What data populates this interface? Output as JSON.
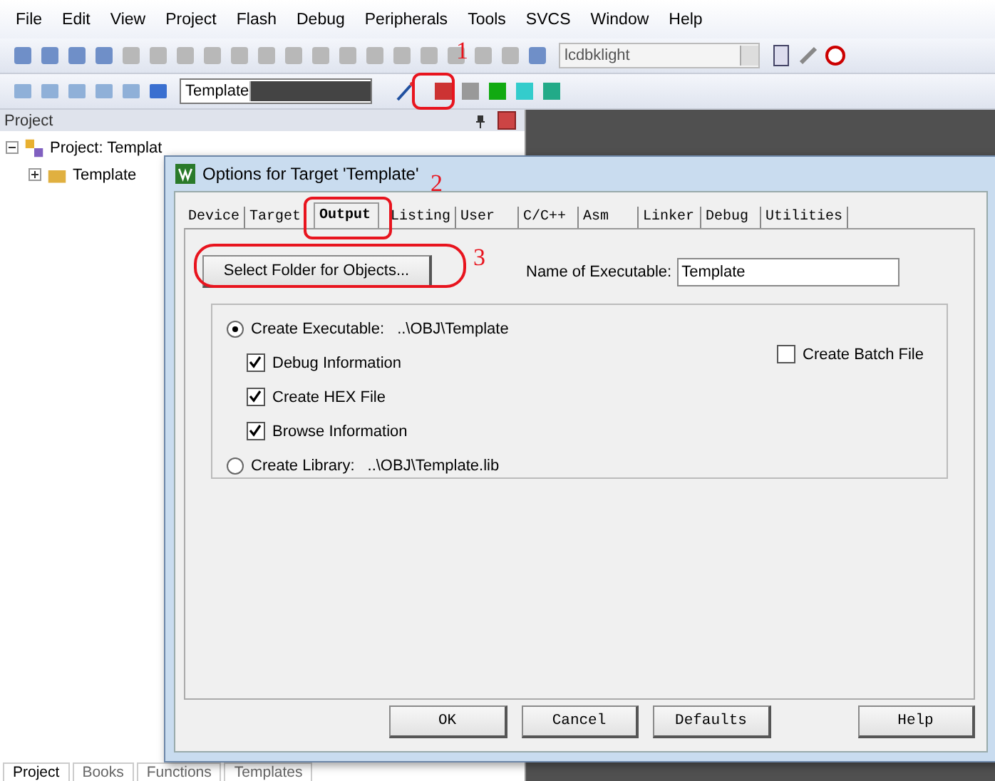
{
  "menu": [
    {
      "label": "File"
    },
    {
      "label": "Edit"
    },
    {
      "label": "View"
    },
    {
      "label": "Project"
    },
    {
      "label": "Flash"
    },
    {
      "label": "Debug"
    },
    {
      "label": "Peripherals"
    },
    {
      "label": "Tools"
    },
    {
      "label": "SVCS"
    },
    {
      "label": "Window"
    },
    {
      "label": "Help"
    }
  ],
  "toolbar": {
    "config_select": "lcdbklight",
    "target_select": "Template"
  },
  "project_panel": {
    "title": "Project",
    "tree": [
      {
        "label": "Project: Templat",
        "expanded": true,
        "children": [
          {
            "label": "Template",
            "expanded": false
          }
        ]
      }
    ]
  },
  "bottom_tabs": [
    {
      "label": "Project",
      "selected": true
    },
    {
      "label": "Books",
      "selected": false
    },
    {
      "label": "Functions",
      "selected": false
    },
    {
      "label": "Templates",
      "selected": false
    }
  ],
  "dialog": {
    "title": "Options for Target 'Template'",
    "tabs": [
      {
        "label": "Device",
        "selected": false
      },
      {
        "label": "Target",
        "selected": false
      },
      {
        "label": "Output",
        "selected": true
      },
      {
        "label": "Listing",
        "selected": false
      },
      {
        "label": "User",
        "selected": false
      },
      {
        "label": "C/C++",
        "selected": false
      },
      {
        "label": "Asm",
        "selected": false
      },
      {
        "label": "Linker",
        "selected": false
      },
      {
        "label": "Debug",
        "selected": false
      },
      {
        "label": "Utilities",
        "selected": false
      }
    ],
    "select_folder_button": "Select Folder for Objects...",
    "name_label": "Name of Executable:",
    "name_value": "Template",
    "create_executable": {
      "label": "Create Executable:",
      "path": "..\\OBJ\\Template",
      "selected": true
    },
    "options": [
      {
        "label": "Debug Information",
        "checked": true
      },
      {
        "label": "Create HEX File",
        "checked": true
      },
      {
        "label": "Browse Information",
        "checked": true
      }
    ],
    "batch_file": {
      "label": "Create Batch File",
      "checked": false
    },
    "create_library": {
      "label": "Create Library:",
      "path": "..\\OBJ\\Template.lib",
      "selected": false
    },
    "buttons": [
      {
        "label": "OK"
      },
      {
        "label": "Cancel"
      },
      {
        "label": "Defaults"
      },
      {
        "label": "Help"
      }
    ]
  },
  "annotations": [
    {
      "label": "1"
    },
    {
      "label": "2"
    },
    {
      "label": "3"
    }
  ]
}
